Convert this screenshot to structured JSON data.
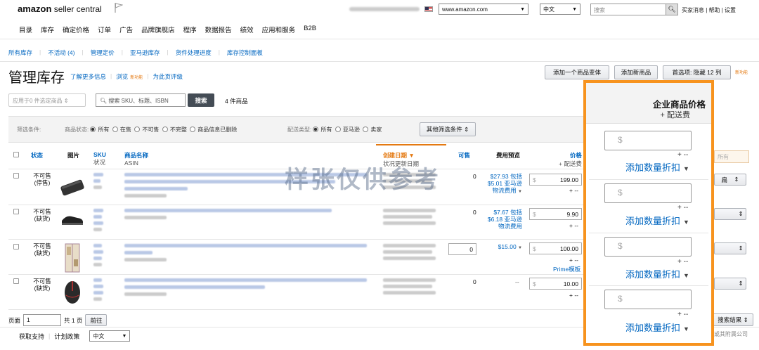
{
  "brand": {
    "logo_main": "amazon",
    "logo_sub": " seller central"
  },
  "header": {
    "marketplace": "www.amazon.com",
    "language": "中文",
    "search_placeholder": "搜索",
    "links": "买家消息 | 帮助 | 设置"
  },
  "nav": [
    "目录",
    "库存",
    "确定价格",
    "订单",
    "广告",
    "品牌旗舰店",
    "程序",
    "数据报告",
    "绩效",
    "应用和服务",
    "B2B"
  ],
  "subnav": [
    "所有库存",
    "不活动 (4)",
    "管理定价",
    "亚马逊库存",
    "货件处理进度",
    "库存控制面板"
  ],
  "page": {
    "title": "管理库存",
    "learn_more": "了解更多信息",
    "browse": "浏览",
    "new_tag": "新功能",
    "rate": "为此页评级",
    "btn_add_variant": "添加一个商品变体",
    "btn_add_product": "添加新商品",
    "btn_prefs": "首选项: 隐藏 12 列"
  },
  "toolbar": {
    "apply_select": "应用于0 件选定商品",
    "search_placeholder": "搜索 SKU、标题、ISBN",
    "search_btn": "搜索",
    "count": "4 件商品"
  },
  "filters": {
    "label": "筛选条件:",
    "status_label": "商品状态:",
    "status_all": "所有",
    "status_active": "在售",
    "status_inactive": "不可售",
    "status_incomplete": "不完整",
    "status_suppressed": "商品信息已删除",
    "fulfill_label": "配送类型:",
    "fulfill_all": "所有",
    "fulfill_amazon": "亚马逊",
    "fulfill_seller": "卖家",
    "more": "其他筛选条件"
  },
  "table": {
    "h_status": "状态",
    "h_image": "图片",
    "h_sku": "SKU",
    "h_sku_sub": "状况",
    "h_name": "商品名称",
    "h_name_sub": "ASIN",
    "h_created": "创建日期",
    "h_created_sub": "状况更新日期",
    "h_avail": "可售",
    "h_fee": "费用预览",
    "h_price": "价格",
    "h_price_sub": "+ 配送费",
    "rows": [
      {
        "status": "不可售\n(停售)",
        "avail": "0",
        "fee1": "$27.93 包括",
        "fee2": "$5.01 亚马逊",
        "fee3": "物流费用",
        "price": "199.00"
      },
      {
        "status": "不可售\n(缺货)",
        "avail": "0",
        "fee1": "$7.67 包括",
        "fee2": "$6.18 亚马逊",
        "fee3": "物流费用",
        "price": "9.90"
      },
      {
        "status": "不可售\n(缺货)",
        "avail": "0",
        "fee1": "$15.00",
        "fee2": "",
        "fee3": "",
        "price": "100.00",
        "extra": "Prime模板"
      },
      {
        "status": "不可售\n(缺货)",
        "avail": "0",
        "fee1": "--",
        "fee2": "",
        "fee3": "",
        "price": "10.00"
      }
    ],
    "plus_dash": "+ --",
    "dollar": "$",
    "all_label": "所有",
    "tail_right": "搜索结果"
  },
  "pager": {
    "label": "页面",
    "page": "1",
    "total": "共 1 页",
    "go": "前往"
  },
  "footer": {
    "support": "获取支持",
    "policy": "计划政策",
    "language": "中文",
    "copyright": "或其附属公司"
  },
  "watermark": "样张仅供参考",
  "panel": {
    "title": "企业商品价格",
    "subtitle": "+ 配送费",
    "dollar": "$",
    "plus_dash": "+ --",
    "discount": "添加数量折扣"
  },
  "colors": {
    "accent": "#f7931e",
    "link": "#0066c0",
    "orange_text": "#e47911"
  }
}
